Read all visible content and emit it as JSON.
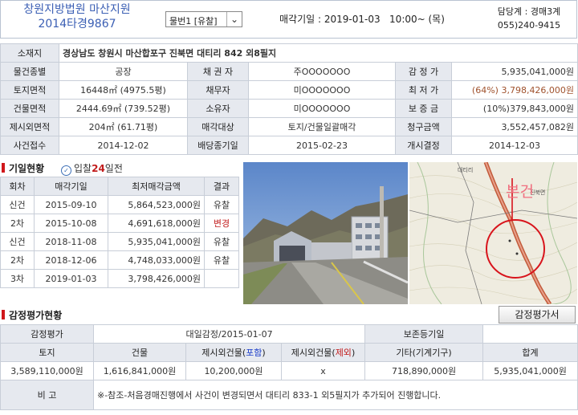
{
  "header": {
    "court": "창원지방법원 마산지원",
    "case_no": "2014타경9867",
    "item_select": "물번1 [유찰]",
    "sale_date_label": "매각기일",
    "sale_date_value": "2019-01-03",
    "sale_time": "10:00~ (목)",
    "dept": "담당계 : 경매3계",
    "tel": "055)240-9415"
  },
  "info": {
    "address_label": "소재지",
    "address": "경상남도 창원시 마산합포구 진북면 대티리 842 외8필지",
    "rows": [
      [
        "물건종별",
        "공장",
        "채 권 자",
        "주OOOOOOO",
        "감 정 가",
        "5,935,041,000원"
      ],
      [
        "토지면적",
        "16448㎡ (4975.5평)",
        "채무자",
        "미OOOOOOO",
        "최 저 가",
        "(64%) 3,798,426,000원"
      ],
      [
        "건물면적",
        "2444.69㎡ (739.52평)",
        "소유자",
        "미OOOOOOO",
        "보 증 금",
        "(10%)379,843,000원"
      ],
      [
        "제시외면적",
        "204㎡ (61.71평)",
        "매각대상",
        "토지/건물일괄매각",
        "청구금액",
        "3,552,457,082원"
      ],
      [
        "사건접수",
        "2014-12-02",
        "배당종기일",
        "2015-02-23",
        "개시결정",
        "2014-12-03"
      ]
    ]
  },
  "bidding": {
    "title": "기일현황",
    "days_prefix": "입찰",
    "days_num": "24",
    "days_suffix": "일전",
    "headers": [
      "회차",
      "매각기일",
      "최저매각금액",
      "결과"
    ],
    "rows": [
      [
        "신건",
        "2015-09-10",
        "5,864,523,000원",
        "유찰"
      ],
      [
        "2차",
        "2015-10-08",
        "4,691,618,000원",
        "변경"
      ],
      [
        "신건",
        "2018-11-08",
        "5,935,041,000원",
        "유찰"
      ],
      [
        "2차",
        "2018-12-06",
        "4,748,033,000원",
        "유찰"
      ],
      [
        "3차",
        "2019-01-03",
        "3,798,426,000원",
        ""
      ]
    ]
  },
  "map": {
    "label": "본건"
  },
  "appraisal": {
    "title": "감정평가현황",
    "button": "감정평가서",
    "row1": [
      "감정평가",
      "대일감정/2015-01-07",
      "보존등기일",
      ""
    ],
    "headers": [
      "토지",
      "건물",
      "제시외건물(포함)",
      "제시외건물(제외)",
      "기타(기계기구)",
      "합계"
    ],
    "header_hl_include": "포함",
    "header_hl_exclude": "제외",
    "values": [
      "3,589,110,000원",
      "1,616,841,000원",
      "10,200,000원",
      "x",
      "718,890,000원",
      "5,935,041,000원"
    ],
    "note_label": "비 고",
    "note": "※-참조-처음경매진행에서 사건이 변경되면서 대티리 833-1 외5필지가 추가되어 진행합니다."
  },
  "colors": {
    "accent_blue": "#3b5fb4",
    "red": "#c21d1d",
    "header_bg": "#e6e9ef"
  }
}
